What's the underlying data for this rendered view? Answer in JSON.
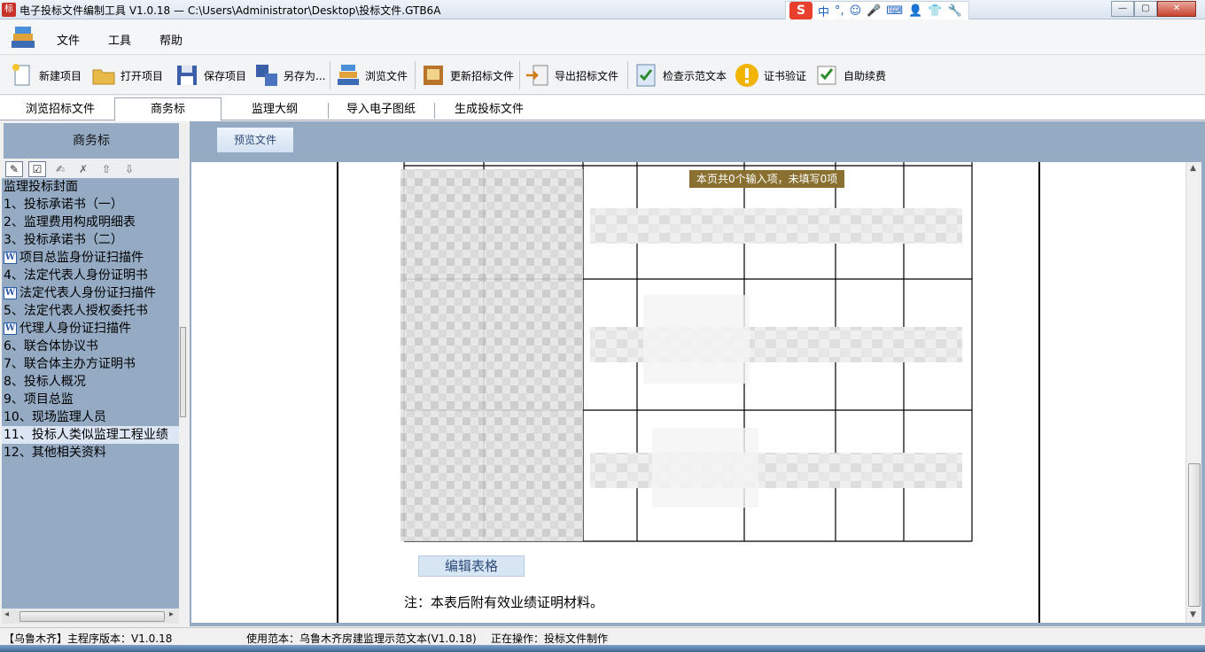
{
  "window": {
    "title": "电子投标文件编制工具 V1.0.18 — C:\\Users\\Administrator\\Desktop\\投标文件.GTB6A",
    "ime_label": "中"
  },
  "menu": [
    "文件",
    "工具",
    "帮助"
  ],
  "toolbar": {
    "new_project": "新建项目",
    "open_project": "打开项目",
    "save_project": "保存项目",
    "save_as": "另存为...",
    "browse_file": "浏览文件",
    "update_tender": "更新招标文件",
    "export_tender": "导出招标文件",
    "check_sample": "检查示范文本",
    "cert_verify": "证书验证",
    "auto_renew": "自助续费"
  },
  "tabs": [
    "浏览招标文件",
    "商务标",
    "监理大纲",
    "导入电子图纸",
    "生成投标文件"
  ],
  "active_tab_index": 1,
  "left_panel": {
    "header": "商务标",
    "items": [
      {
        "label": "监理投标封面",
        "word": false
      },
      {
        "label": "1、投标承诺书（一）",
        "word": false
      },
      {
        "label": "2、监理费用构成明细表",
        "word": false
      },
      {
        "label": "3、投标承诺书（二）",
        "word": false
      },
      {
        "label": "项目总监身份证扫描件",
        "word": true
      },
      {
        "label": "4、法定代表人身份证明书",
        "word": false
      },
      {
        "label": "法定代表人身份证扫描件",
        "word": true
      },
      {
        "label": "5、法定代表人授权委托书",
        "word": false
      },
      {
        "label": "代理人身份证扫描件",
        "word": true
      },
      {
        "label": "6、联合体协议书",
        "word": false
      },
      {
        "label": "7、联合体主办方证明书",
        "word": false
      },
      {
        "label": "8、投标人概况",
        "word": false
      },
      {
        "label": "9、项目总监",
        "word": false
      },
      {
        "label": "10、现场监理人员",
        "word": false
      },
      {
        "label": "11、投标人类似监理工程业绩",
        "word": false,
        "selected": true
      },
      {
        "label": "12、其他相关资料",
        "word": false
      }
    ]
  },
  "main": {
    "preview_button": "预览文件",
    "tip": "本页共0个输入项，未填写0项",
    "edit_table_button": "编辑表格",
    "note": "注：本表后附有效业绩证明材料。"
  },
  "statusbar": {
    "version": "【乌鲁木齐】主程序版本：V1.0.18",
    "template": "使用范本：乌鲁木齐房建监理示范文本(V1.0.18)",
    "operation": "正在操作：投标文件制作"
  }
}
